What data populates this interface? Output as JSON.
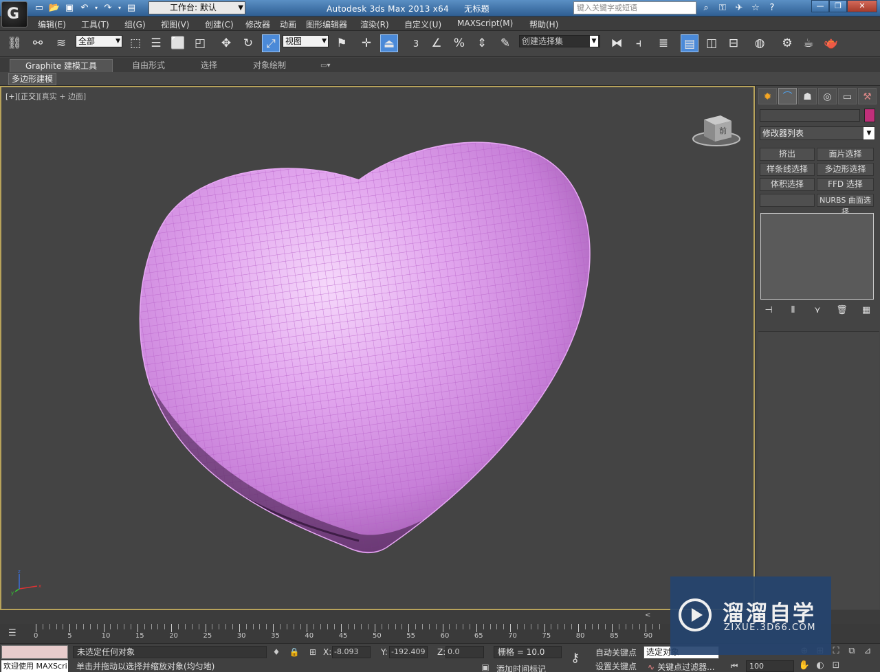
{
  "app": {
    "title": "Autodesk 3ds Max  2013 x64",
    "document": "无标题",
    "logo_text": "G"
  },
  "titlebar": {
    "workspace_label": "工作台: 默认",
    "search_placeholder": "键入关键字或短语",
    "quick_icons": [
      "new-file-icon",
      "open-file-icon",
      "save-icon",
      "undo-icon",
      "redo-icon",
      "project-folder-icon"
    ],
    "tools": [
      "binoculars-icon",
      "key-tool-icon",
      "satellite-icon",
      "star-icon",
      "help-icon"
    ]
  },
  "menu": {
    "items": [
      {
        "label": "编辑(E)"
      },
      {
        "label": "工具(T)"
      },
      {
        "label": "组(G)"
      },
      {
        "label": "视图(V)"
      },
      {
        "label": "创建(C)"
      },
      {
        "label": "修改器"
      },
      {
        "label": "动画"
      },
      {
        "label": "图形编辑器"
      },
      {
        "label": "渲染(R)"
      },
      {
        "label": "自定义(U)"
      },
      {
        "label": "MAXScript(M)"
      },
      {
        "label": "帮助(H)"
      }
    ]
  },
  "toolbar": {
    "filter_value": "全部",
    "refcoord_value": "视图",
    "named_selection_value": "创建选择集",
    "snap_label": "3"
  },
  "ribbon": {
    "tabs": [
      {
        "label": "Graphite 建模工具"
      },
      {
        "label": "自由形式"
      },
      {
        "label": "选择"
      },
      {
        "label": "对象绘制"
      }
    ],
    "subtab": "多边形建模"
  },
  "viewport": {
    "label_bracket1": "[+]",
    "label_bracket2": "[正交]",
    "label_bracket3": "[真实 + 边面]",
    "viewcube_label": "前",
    "object_color": "#d98be8"
  },
  "command_panel": {
    "modifier_list": "修改器列表",
    "buttons": [
      {
        "label": "挤出"
      },
      {
        "label": "面片选择"
      },
      {
        "label": "样条线选择"
      },
      {
        "label": "多边形选择"
      },
      {
        "label": "体积选择"
      },
      {
        "label": "FFD 选择"
      },
      {
        "label": ""
      },
      {
        "label": "NURBS 曲面选择"
      }
    ],
    "object_color": "#c02f7a"
  },
  "timeline": {
    "ticks": [
      "0",
      "5",
      "10",
      "15",
      "20",
      "25",
      "30",
      "35",
      "40",
      "45",
      "50",
      "55",
      "60",
      "65",
      "70",
      "75",
      "80",
      "85",
      "90"
    ]
  },
  "status": {
    "welcome": "欢迎使用 MAXScri",
    "selection": "未选定任何对象",
    "prompt": "单击并拖动以选择并缩放对象(均匀地)",
    "x_label": "X:",
    "x_value": "-8.093",
    "y_label": "Y:",
    "y_value": "-192.409",
    "z_label": "Z:",
    "z_value": "0.0",
    "grid": "栅格 = 10.0",
    "add_time_tag": "添加时间标记",
    "auto_key": "自动关键点",
    "set_key": "设置关键点",
    "selected_object": "选定对象",
    "key_filters": "关键点过滤器...",
    "frame": "100"
  },
  "watermark": {
    "title": "溜溜自学",
    "url": "ZIXUE.3D66.COM"
  }
}
